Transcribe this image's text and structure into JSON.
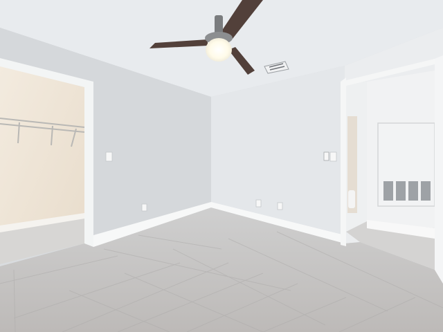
{
  "scene": {
    "description_tags": [
      "empty-bedroom",
      "ceiling-fan",
      "walk-in-closet",
      "doorway",
      "tile-floor"
    ],
    "colors": {
      "ceiling": "#e7ebee",
      "wall_left": "#d3d7da",
      "wall_back": "#e4e7ea",
      "wall_right": "#e9ebee",
      "closet_wall": "#efe6da",
      "floor": "#c9c7c5",
      "trim": "#f6f7f7",
      "fan_blade": "#4f3c36",
      "fan_light": "#fffef6"
    }
  }
}
